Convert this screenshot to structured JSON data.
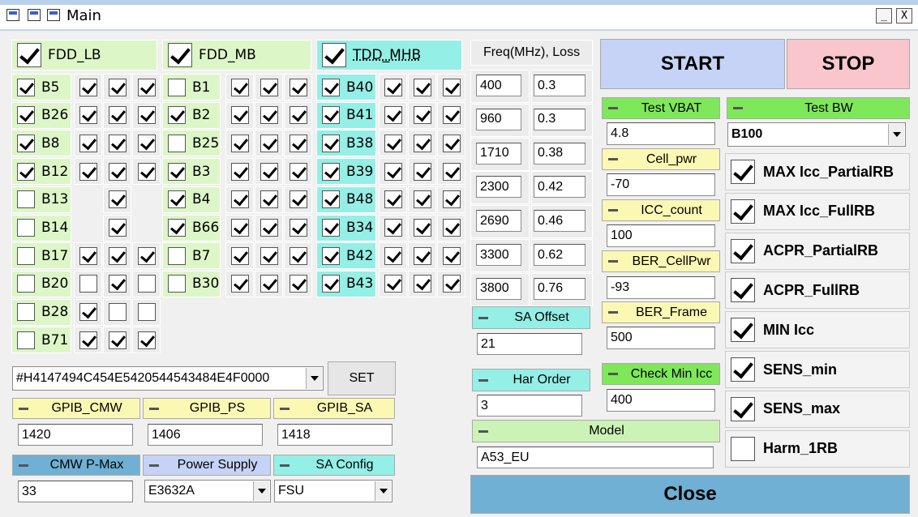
{
  "window": {
    "title": "Main",
    "minimize": "_",
    "maximize": "□",
    "close": "X"
  },
  "fdd_lb": {
    "header": "FDD_LB",
    "header_checked": true,
    "bands": [
      {
        "label": "B5",
        "checked": true,
        "opts": [
          true,
          true,
          true
        ]
      },
      {
        "label": "B26",
        "checked": true,
        "opts": [
          true,
          true,
          true
        ]
      },
      {
        "label": "B8",
        "checked": true,
        "opts": [
          true,
          true,
          true
        ]
      },
      {
        "label": "B12",
        "checked": true,
        "opts": [
          true,
          true,
          true
        ]
      },
      {
        "label": "B13",
        "checked": false,
        "opts": [
          null,
          true,
          null
        ]
      },
      {
        "label": "B14",
        "checked": false,
        "opts": [
          null,
          true,
          null
        ]
      },
      {
        "label": "B17",
        "checked": false,
        "opts": [
          true,
          true,
          true
        ]
      },
      {
        "label": "B20",
        "checked": false,
        "opts": [
          false,
          true,
          false
        ]
      },
      {
        "label": "B28",
        "checked": false,
        "opts": [
          true,
          false,
          false
        ]
      },
      {
        "label": "B71",
        "checked": false,
        "opts": [
          true,
          true,
          true
        ]
      }
    ]
  },
  "fdd_mb": {
    "header": "FDD_MB",
    "header_checked": true,
    "bands": [
      {
        "label": "B1",
        "checked": false,
        "opts": [
          true,
          true,
          true
        ]
      },
      {
        "label": "B2",
        "checked": true,
        "opts": [
          true,
          true,
          true
        ]
      },
      {
        "label": "B25",
        "checked": false,
        "opts": [
          true,
          true,
          true
        ]
      },
      {
        "label": "B3",
        "checked": true,
        "opts": [
          true,
          true,
          true
        ]
      },
      {
        "label": "B4",
        "checked": true,
        "opts": [
          true,
          true,
          true
        ]
      },
      {
        "label": "B66",
        "checked": true,
        "opts": [
          true,
          true,
          true
        ]
      },
      {
        "label": "B7",
        "checked": false,
        "opts": [
          true,
          true,
          true
        ]
      },
      {
        "label": "B30",
        "checked": false,
        "opts": [
          true,
          true,
          true
        ]
      }
    ]
  },
  "tdd_mhb": {
    "header": "TDD_MHB",
    "header_checked": true,
    "bands": [
      {
        "label": "B40",
        "checked": true,
        "opts": [
          true,
          true,
          true
        ]
      },
      {
        "label": "B41",
        "checked": true,
        "opts": [
          true,
          true,
          true
        ]
      },
      {
        "label": "B38",
        "checked": true,
        "opts": [
          true,
          true,
          true
        ]
      },
      {
        "label": "B39",
        "checked": true,
        "opts": [
          true,
          true,
          true
        ]
      },
      {
        "label": "B48",
        "checked": true,
        "opts": [
          true,
          true,
          true
        ]
      },
      {
        "label": "B34",
        "checked": true,
        "opts": [
          true,
          true,
          true
        ]
      },
      {
        "label": "B42",
        "checked": true,
        "opts": [
          true,
          true,
          true
        ]
      },
      {
        "label": "B43",
        "checked": true,
        "opts": [
          true,
          true,
          true
        ]
      }
    ]
  },
  "loss": {
    "header": "Freq(MHz), Loss",
    "rows": [
      {
        "freq": "400",
        "loss": "0.3"
      },
      {
        "freq": "960",
        "loss": "0.3"
      },
      {
        "freq": "1710",
        "loss": "0.38"
      },
      {
        "freq": "2300",
        "loss": "0.42"
      },
      {
        "freq": "2690",
        "loss": "0.46"
      },
      {
        "freq": "3300",
        "loss": "0.62"
      },
      {
        "freq": "3800",
        "loss": "0.76"
      }
    ]
  },
  "sa_offset": {
    "label": "SA Offset",
    "value": "21"
  },
  "har_order": {
    "label": "Har Order",
    "value": "3"
  },
  "model": {
    "label": "Model",
    "value": "A53_EU"
  },
  "gpib": {
    "address": "#H4147494C454E5420544543484E4F0000",
    "set_label": "SET",
    "cmw": {
      "label": "GPIB_CMW",
      "value": "1420"
    },
    "ps": {
      "label": "GPIB_PS",
      "value": "1406"
    },
    "sa": {
      "label": "GPIB_SA",
      "value": "1418"
    }
  },
  "cmw_pmax": {
    "label": "CMW P-Max",
    "value": "33"
  },
  "power_supply": {
    "label": "Power Supply",
    "value": "E3632A"
  },
  "sa_config": {
    "label": "SA Config",
    "value": "FSU"
  },
  "controls": {
    "start": "START",
    "stop": "STOP",
    "close": "Close"
  },
  "vbat": {
    "label": "Test VBAT",
    "value": "4.8"
  },
  "cell_pwr": {
    "label": "Cell_pwr",
    "value": "-70"
  },
  "icc_count": {
    "label": "ICC_count",
    "value": "100"
  },
  "ber_cellpwr": {
    "label": "BER_CellPwr",
    "value": "-93"
  },
  "ber_frame": {
    "label": "BER_Frame",
    "value": "500"
  },
  "check_min_icc": {
    "label": "Check Min Icc",
    "value": "400"
  },
  "test_bw": {
    "label": "Test BW",
    "value": "B100"
  },
  "tests": [
    {
      "label": "MAX Icc_PartialRB",
      "checked": true
    },
    {
      "label": "MAX Icc_FullRB",
      "checked": true
    },
    {
      "label": "ACPR_PartialRB",
      "checked": true
    },
    {
      "label": "ACPR_FullRB",
      "checked": true
    },
    {
      "label": "MIN Icc",
      "checked": true
    },
    {
      "label": "SENS_min",
      "checked": true
    },
    {
      "label": "SENS_max",
      "checked": true
    },
    {
      "label": "Harm_1RB",
      "checked": false
    }
  ],
  "colors": {
    "green": "#ccf3b6",
    "teal": "#94efe6",
    "yellow": "#fbf8b4",
    "start": "#c6d3f6",
    "stop": "#f8c6cc",
    "close": "#6fb0d4"
  }
}
